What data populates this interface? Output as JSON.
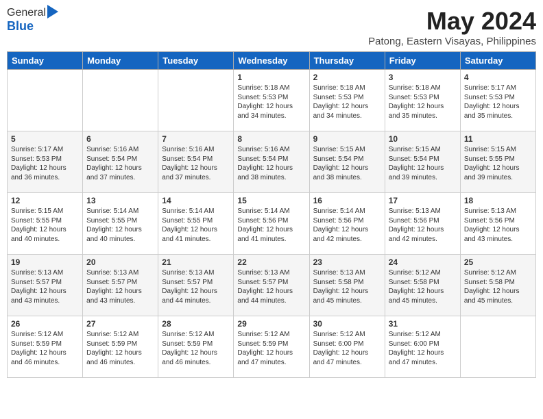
{
  "logo": {
    "general": "General",
    "blue": "Blue"
  },
  "header": {
    "month": "May 2024",
    "location": "Patong, Eastern Visayas, Philippines"
  },
  "days_of_week": [
    "Sunday",
    "Monday",
    "Tuesday",
    "Wednesday",
    "Thursday",
    "Friday",
    "Saturday"
  ],
  "weeks": [
    [
      {
        "day": "",
        "info": ""
      },
      {
        "day": "",
        "info": ""
      },
      {
        "day": "",
        "info": ""
      },
      {
        "day": "1",
        "info": "Sunrise: 5:18 AM\nSunset: 5:53 PM\nDaylight: 12 hours\nand 34 minutes."
      },
      {
        "day": "2",
        "info": "Sunrise: 5:18 AM\nSunset: 5:53 PM\nDaylight: 12 hours\nand 34 minutes."
      },
      {
        "day": "3",
        "info": "Sunrise: 5:18 AM\nSunset: 5:53 PM\nDaylight: 12 hours\nand 35 minutes."
      },
      {
        "day": "4",
        "info": "Sunrise: 5:17 AM\nSunset: 5:53 PM\nDaylight: 12 hours\nand 35 minutes."
      }
    ],
    [
      {
        "day": "5",
        "info": "Sunrise: 5:17 AM\nSunset: 5:53 PM\nDaylight: 12 hours\nand 36 minutes."
      },
      {
        "day": "6",
        "info": "Sunrise: 5:16 AM\nSunset: 5:54 PM\nDaylight: 12 hours\nand 37 minutes."
      },
      {
        "day": "7",
        "info": "Sunrise: 5:16 AM\nSunset: 5:54 PM\nDaylight: 12 hours\nand 37 minutes."
      },
      {
        "day": "8",
        "info": "Sunrise: 5:16 AM\nSunset: 5:54 PM\nDaylight: 12 hours\nand 38 minutes."
      },
      {
        "day": "9",
        "info": "Sunrise: 5:15 AM\nSunset: 5:54 PM\nDaylight: 12 hours\nand 38 minutes."
      },
      {
        "day": "10",
        "info": "Sunrise: 5:15 AM\nSunset: 5:54 PM\nDaylight: 12 hours\nand 39 minutes."
      },
      {
        "day": "11",
        "info": "Sunrise: 5:15 AM\nSunset: 5:55 PM\nDaylight: 12 hours\nand 39 minutes."
      }
    ],
    [
      {
        "day": "12",
        "info": "Sunrise: 5:15 AM\nSunset: 5:55 PM\nDaylight: 12 hours\nand 40 minutes."
      },
      {
        "day": "13",
        "info": "Sunrise: 5:14 AM\nSunset: 5:55 PM\nDaylight: 12 hours\nand 40 minutes."
      },
      {
        "day": "14",
        "info": "Sunrise: 5:14 AM\nSunset: 5:55 PM\nDaylight: 12 hours\nand 41 minutes."
      },
      {
        "day": "15",
        "info": "Sunrise: 5:14 AM\nSunset: 5:56 PM\nDaylight: 12 hours\nand 41 minutes."
      },
      {
        "day": "16",
        "info": "Sunrise: 5:14 AM\nSunset: 5:56 PM\nDaylight: 12 hours\nand 42 minutes."
      },
      {
        "day": "17",
        "info": "Sunrise: 5:13 AM\nSunset: 5:56 PM\nDaylight: 12 hours\nand 42 minutes."
      },
      {
        "day": "18",
        "info": "Sunrise: 5:13 AM\nSunset: 5:56 PM\nDaylight: 12 hours\nand 43 minutes."
      }
    ],
    [
      {
        "day": "19",
        "info": "Sunrise: 5:13 AM\nSunset: 5:57 PM\nDaylight: 12 hours\nand 43 minutes."
      },
      {
        "day": "20",
        "info": "Sunrise: 5:13 AM\nSunset: 5:57 PM\nDaylight: 12 hours\nand 43 minutes."
      },
      {
        "day": "21",
        "info": "Sunrise: 5:13 AM\nSunset: 5:57 PM\nDaylight: 12 hours\nand 44 minutes."
      },
      {
        "day": "22",
        "info": "Sunrise: 5:13 AM\nSunset: 5:57 PM\nDaylight: 12 hours\nand 44 minutes."
      },
      {
        "day": "23",
        "info": "Sunrise: 5:13 AM\nSunset: 5:58 PM\nDaylight: 12 hours\nand 45 minutes."
      },
      {
        "day": "24",
        "info": "Sunrise: 5:12 AM\nSunset: 5:58 PM\nDaylight: 12 hours\nand 45 minutes."
      },
      {
        "day": "25",
        "info": "Sunrise: 5:12 AM\nSunset: 5:58 PM\nDaylight: 12 hours\nand 45 minutes."
      }
    ],
    [
      {
        "day": "26",
        "info": "Sunrise: 5:12 AM\nSunset: 5:59 PM\nDaylight: 12 hours\nand 46 minutes."
      },
      {
        "day": "27",
        "info": "Sunrise: 5:12 AM\nSunset: 5:59 PM\nDaylight: 12 hours\nand 46 minutes."
      },
      {
        "day": "28",
        "info": "Sunrise: 5:12 AM\nSunset: 5:59 PM\nDaylight: 12 hours\nand 46 minutes."
      },
      {
        "day": "29",
        "info": "Sunrise: 5:12 AM\nSunset: 5:59 PM\nDaylight: 12 hours\nand 47 minutes."
      },
      {
        "day": "30",
        "info": "Sunrise: 5:12 AM\nSunset: 6:00 PM\nDaylight: 12 hours\nand 47 minutes."
      },
      {
        "day": "31",
        "info": "Sunrise: 5:12 AM\nSunset: 6:00 PM\nDaylight: 12 hours\nand 47 minutes."
      },
      {
        "day": "",
        "info": ""
      }
    ]
  ]
}
